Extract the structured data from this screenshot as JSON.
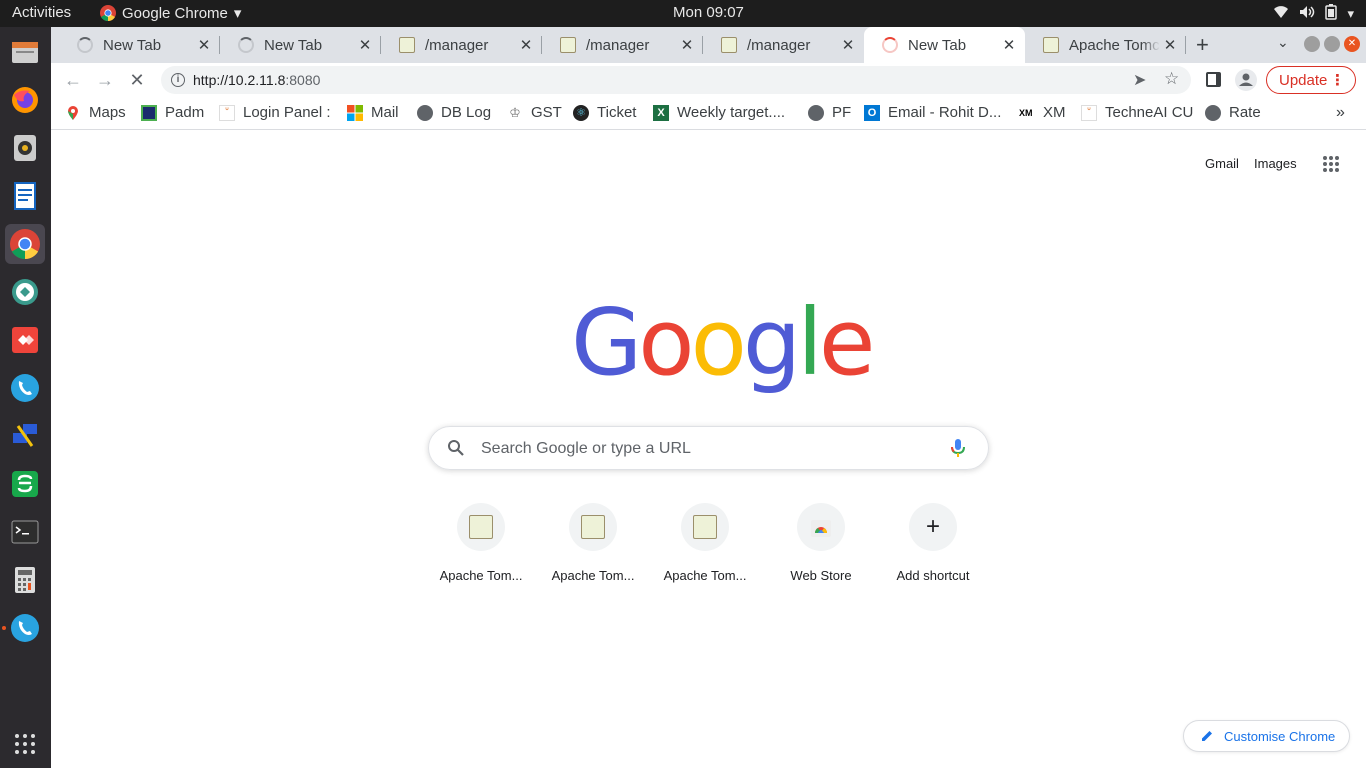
{
  "system": {
    "activities": "Activities",
    "app_name": "Google Chrome",
    "clock": "Mon 09:07"
  },
  "dock": {
    "items": [
      "files-icon",
      "firefox-icon",
      "rhythmbox-icon",
      "writer-icon",
      "chrome-icon",
      "remmina-icon",
      "anydesk-icon",
      "softphone-icon",
      "remote-desktop-icon",
      "spreadsheet-icon",
      "terminal-icon",
      "calculator-icon",
      "phone-icon"
    ],
    "show_apps": "show-apps-icon"
  },
  "tabs": [
    {
      "title": "New Tab",
      "icon": "loading-spinner-icon"
    },
    {
      "title": "New Tab",
      "icon": "loading-spinner-icon"
    },
    {
      "title": "/manager",
      "icon": "tomcat-icon"
    },
    {
      "title": "/manager",
      "icon": "tomcat-icon"
    },
    {
      "title": "/manager",
      "icon": "tomcat-icon"
    },
    {
      "title": "New Tab",
      "icon": "loading-spinner-icon",
      "active": true
    },
    {
      "title": "Apache Tomcat",
      "icon": "tomcat-icon"
    }
  ],
  "omnibox": {
    "url_host": "http://10.2.11.8",
    "url_port": ":8080"
  },
  "toolbar": {
    "update_label": "Update"
  },
  "bookmarks": [
    {
      "label": "Maps",
      "icon": "maps-icon"
    },
    {
      "label": "Padm",
      "icon": "padm-icon"
    },
    {
      "label": "Login Panel :",
      "icon": "login-icon"
    },
    {
      "label": "Mail",
      "icon": "microsoft-icon"
    },
    {
      "label": "DB Log",
      "icon": "globe-icon"
    },
    {
      "label": "GST",
      "icon": "emblem-icon"
    },
    {
      "label": "Ticket",
      "icon": "react-icon"
    },
    {
      "label": "Weekly target....",
      "icon": "excel-icon"
    },
    {
      "label": "PF",
      "icon": "globe-icon"
    },
    {
      "label": "Email - Rohit D...",
      "icon": "outlook-icon"
    },
    {
      "label": "XM",
      "icon": "xm-icon"
    },
    {
      "label": "TechneAI CU",
      "icon": "login-icon"
    },
    {
      "label": "Rate",
      "icon": "globe-icon"
    }
  ],
  "ntp": {
    "gmail": "Gmail",
    "images": "Images",
    "logo": "Google",
    "search_placeholder": "Search Google or type a URL",
    "shortcuts": [
      {
        "label": "Apache Tom...",
        "icon": "tomcat-icon"
      },
      {
        "label": "Apache Tom...",
        "icon": "tomcat-icon"
      },
      {
        "label": "Apache Tom...",
        "icon": "tomcat-icon"
      },
      {
        "label": "Web Store",
        "icon": "webstore-icon"
      },
      {
        "label": "Add shortcut",
        "icon": "plus-icon"
      }
    ],
    "customise": "Customise Chrome"
  },
  "colors": {
    "google_blue": "#4f5bd5",
    "google_red": "#ea4335",
    "google_yellow": "#fbbc05",
    "google_green": "#34a853",
    "update_red": "#d93025",
    "link_blue": "#1a73e8"
  }
}
